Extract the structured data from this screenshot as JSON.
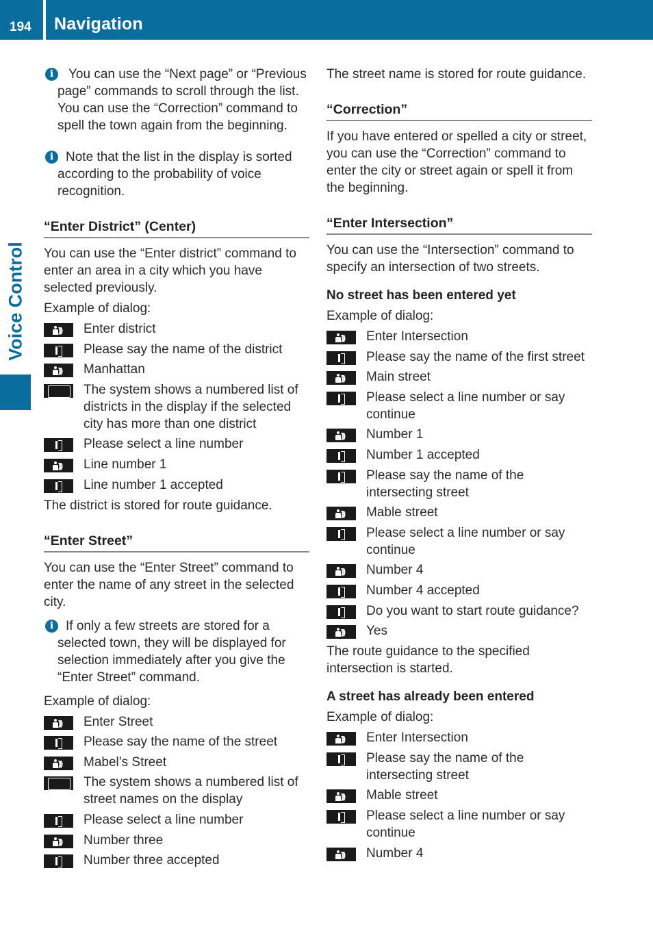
{
  "header": {
    "page_number": "194",
    "section_title": "Navigation"
  },
  "side_tab": {
    "label": "Voice Control"
  },
  "colors": {
    "brand_blue": "#0a6d9c",
    "icon_black": "#1a1a1a",
    "rule_gray": "#8a8a8a"
  },
  "left_column": {
    "info1": "You can use the “Next page” or “Previous page” commands to scroll through the list. You can use the “Correction” command to spell the town again from the beginning.",
    "info2": "Note that the list in the display is sorted according to the probability of voice recognition.",
    "district": {
      "heading": "“Enter District” (Center)",
      "intro": "You can use the “Enter district” command to enter an area in a city which you have selected previously.",
      "example_label": "Example of dialog:",
      "dialog": [
        {
          "icon": "voice-command-icon",
          "text": "Enter district"
        },
        {
          "icon": "speaker-icon",
          "text": "Please say the name of the district"
        },
        {
          "icon": "voice-command-icon",
          "text": "Manhattan"
        },
        {
          "icon": "display-icon",
          "text": "The system shows a numbered list of districts in the display if the selected city has more than one district"
        },
        {
          "icon": "speaker-icon",
          "text": "Please select a line number"
        },
        {
          "icon": "voice-command-icon",
          "text": "Line number 1"
        },
        {
          "icon": "speaker-icon",
          "text": "Line number 1 accepted"
        }
      ],
      "outro": "The district is stored for route guidance."
    },
    "street": {
      "heading": "“Enter Street”",
      "intro": "You can use the “Enter Street” command to enter the name of any street in the selected city.",
      "info": "If only a few streets are stored for a selected town, they will be displayed for selection immediately after you give the “Enter Street” command.",
      "example_label": "Example of dialog:",
      "dialog": [
        {
          "icon": "voice-command-icon",
          "text": "Enter Street"
        },
        {
          "icon": "speaker-icon",
          "text": "Please say the name of the street"
        },
        {
          "icon": "voice-command-icon",
          "text": "Mabel’s Street"
        },
        {
          "icon": "display-icon",
          "text": "The system shows a numbered list of street names on the display"
        },
        {
          "icon": "speaker-icon",
          "text": "Please select a line number"
        },
        {
          "icon": "voice-command-icon",
          "text": "Number three"
        },
        {
          "icon": "speaker-icon",
          "text": "Number three accepted"
        }
      ]
    }
  },
  "right_column": {
    "street_stored": "The street name is stored for route guidance.",
    "correction": {
      "heading": "“Correction”",
      "body": "If you have entered or spelled a city or street, you can use the “Correction” command to enter the city or street again or spell it from the beginning."
    },
    "intersection": {
      "heading": "“Enter Intersection”",
      "intro": "You can use the “Intersection” command to specify an intersection of two streets.",
      "no_street": {
        "subheading": "No street has been entered yet",
        "example_label": "Example of dialog:",
        "dialog": [
          {
            "icon": "voice-command-icon",
            "text": "Enter Intersection"
          },
          {
            "icon": "speaker-icon",
            "text": "Please say the name of the first street"
          },
          {
            "icon": "voice-command-icon",
            "text": "Main street"
          },
          {
            "icon": "speaker-icon",
            "text": "Please select a line number or say continue"
          },
          {
            "icon": "voice-command-icon",
            "text": "Number 1"
          },
          {
            "icon": "speaker-icon",
            "text": "Number 1 accepted"
          },
          {
            "icon": "speaker-icon",
            "text": "Please say the name of the intersecting street"
          },
          {
            "icon": "voice-command-icon",
            "text": "Mable street"
          },
          {
            "icon": "speaker-icon",
            "text": "Please select a line number or say continue"
          },
          {
            "icon": "voice-command-icon",
            "text": "Number 4"
          },
          {
            "icon": "speaker-icon",
            "text": "Number 4 accepted"
          },
          {
            "icon": "speaker-icon",
            "text": "Do you want to start route guidance?"
          },
          {
            "icon": "voice-command-icon",
            "text": "Yes"
          }
        ],
        "outro": "The route guidance to the specified intersection is started."
      },
      "street_entered": {
        "subheading": "A street has already been entered",
        "example_label": "Example of dialog:",
        "dialog": [
          {
            "icon": "voice-command-icon",
            "text": "Enter Intersection"
          },
          {
            "icon": "speaker-icon",
            "text": "Please say the name of the intersecting street"
          },
          {
            "icon": "voice-command-icon",
            "text": "Mable street"
          },
          {
            "icon": "speaker-icon",
            "text": "Please select a line number or say continue"
          },
          {
            "icon": "voice-command-icon",
            "text": "Number 4"
          }
        ]
      }
    }
  }
}
